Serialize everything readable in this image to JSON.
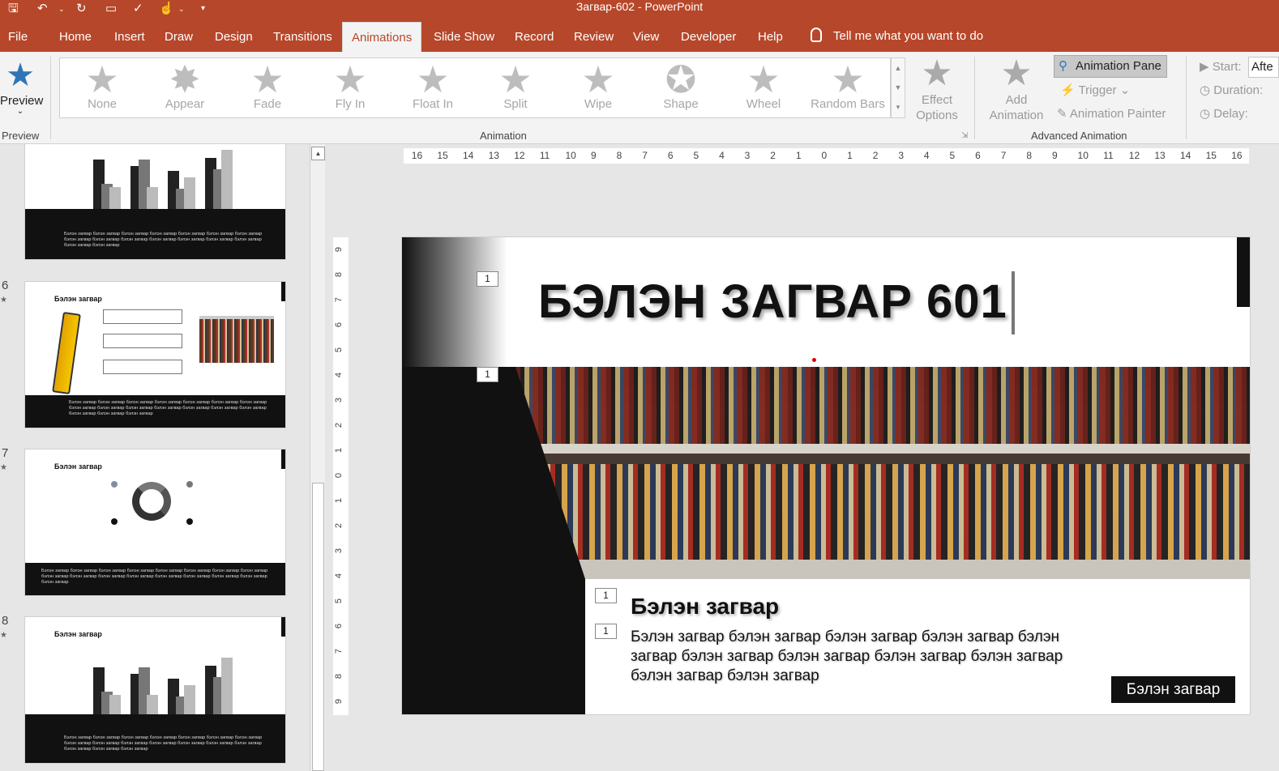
{
  "window": {
    "title": "Загвар-602  -  PowerPoint"
  },
  "tabs": [
    {
      "id": "file",
      "label": "File"
    },
    {
      "id": "home",
      "label": "Home"
    },
    {
      "id": "insert",
      "label": "Insert"
    },
    {
      "id": "draw",
      "label": "Draw"
    },
    {
      "id": "design",
      "label": "Design"
    },
    {
      "id": "transitions",
      "label": "Transitions"
    },
    {
      "id": "animations",
      "label": "Animations"
    },
    {
      "id": "slideshow",
      "label": "Slide Show"
    },
    {
      "id": "record",
      "label": "Record"
    },
    {
      "id": "review",
      "label": "Review"
    },
    {
      "id": "view",
      "label": "View"
    },
    {
      "id": "developer",
      "label": "Developer"
    },
    {
      "id": "help",
      "label": "Help"
    }
  ],
  "active_tab": "Animations",
  "tell_me": "Tell me what you want to do",
  "ribbon": {
    "preview_label": "Preview",
    "preview_group": "Preview",
    "animation_group": "Animation",
    "animations": [
      "None",
      "Appear",
      "Fade",
      "Fly In",
      "Float In",
      "Split",
      "Wipe",
      "Shape",
      "Wheel",
      "Random Bars"
    ],
    "effect_options": [
      "Effect",
      "Options"
    ],
    "add_animation": [
      "Add",
      "Animation"
    ],
    "animation_pane": "Animation Pane",
    "trigger": "Trigger",
    "animation_painter": "Animation Painter",
    "advanced_group": "Advanced Animation",
    "start_label": "Start:",
    "start_value": "Afte",
    "duration_label": "Duration:",
    "delay_label": "Delay:"
  },
  "thumbnails": [
    {
      "num": "",
      "title": "",
      "footer": "Бэлэн загвар бэлэн загвар бэлэн загвар бэлэн загвар бэлэн загвар бэлэн загвар бэлэн загвар бэлэн загвар бэлэн загвар бэлэн загвар бэлэн загвар бэлэн загвар бэлэн загвар бэлэн загвар бэлэн загвар бэлэн загвар"
    },
    {
      "num": "6",
      "title": "Бэлэн загвар",
      "footer": "Бэлэн загвар бэлэн загвар бэлэн загвар бэлэн загвар бэлэн загвар бэлэн загвар бэлэн загвар бэлэн загвар бэлэн загвар бэлэн загвар бэлэн загвар бэлэн загвар бэлэн загвар бэлэн загвар бэлэн загвар бэлэн загвар бэлэн загвар"
    },
    {
      "num": "7",
      "title": "Бэлэн загвар",
      "footer": "Бэлэн загвар бэлэн загвар бэлэн загвар бэлэн загвар бэлэн загвар бэлэн загвар бэлэн загвар бэлэн загвар бэлэн загвар бэлэн загвар бэлэн загвар бэлэн загвар бэлэн загвар бэлэн загвар бэлэн загвар бэлэн загвар бэлэн загвар"
    },
    {
      "num": "8",
      "title": "Бэлэн загвар",
      "footer": "Бэлэн загвар бэлэн загвар бэлэн загвар бэлэн загвар бэлэн загвар бэлэн загвар бэлэн загвар бэлэн загвар бэлэн загвар бэлэн загвар бэлэн загвар бэлэн загвар бэлэн загвар бэлэн загвар бэлэн загвар бэлэн загвар бэлэн загвар"
    }
  ],
  "ruler": {
    "horizontal": [
      "16",
      "15",
      "14",
      "13",
      "12",
      "11",
      "10",
      "9",
      "8",
      "7",
      "6",
      "5",
      "4",
      "3",
      "2",
      "1",
      "0",
      "1",
      "2",
      "3",
      "4",
      "5",
      "6",
      "7",
      "8",
      "9",
      "10",
      "11",
      "12",
      "13",
      "14",
      "15",
      "16"
    ],
    "vertical": [
      "9",
      "8",
      "7",
      "6",
      "5",
      "4",
      "3",
      "2",
      "1",
      "0",
      "1",
      "2",
      "3",
      "4",
      "5",
      "6",
      "7",
      "8",
      "9"
    ]
  },
  "slide": {
    "title": "БЭЛЭН ЗАГВАР 601",
    "subheading": "Бэлэн загвар",
    "body": "Бэлэн загвар бэлэн загвар бэлэн загвар бэлэн загвар бэлэн загвар бэлэн загвар бэлэн загвар бэлэн загвар бэлэн загвар бэлэн загвар бэлэн загвар",
    "button": "Бэлэн загвар",
    "anim_badge": "1"
  },
  "colors": {
    "brand": "#b7472a",
    "accent_dark": "#111111"
  }
}
